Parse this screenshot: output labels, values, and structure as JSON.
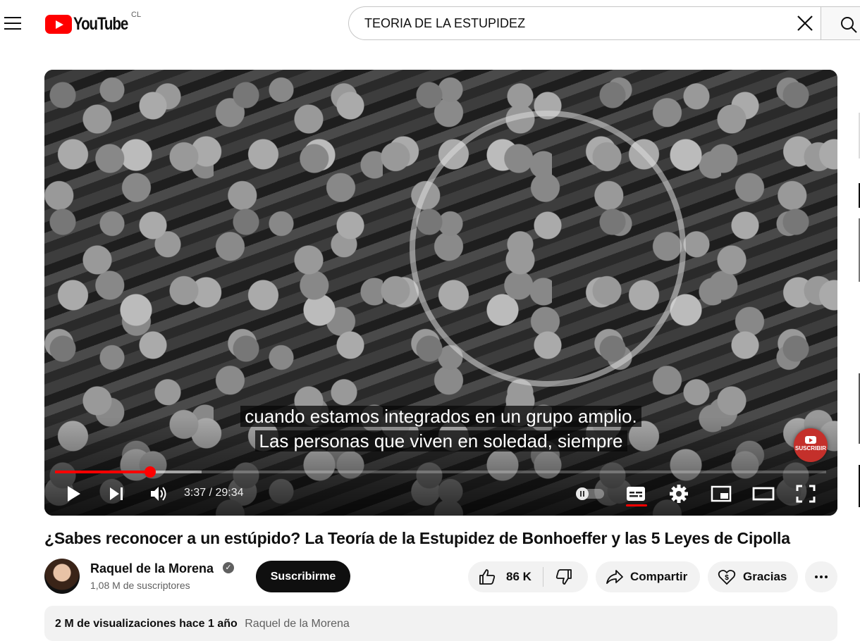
{
  "header": {
    "logo_text": "YouTube",
    "country_code": "CL",
    "search_value": "TEORIA DE LA ESTUPIDEZ"
  },
  "player": {
    "captions": [
      "cuando estamos integrados en un grupo amplio.",
      "Las personas que viven en soledad, siempre"
    ],
    "subscribe_badge_label": "SUSCRIBIR",
    "current_time": "3:37",
    "duration": "29:34",
    "time_display": "3:37 / 29:34",
    "progress_fraction": 0.123,
    "buffered_fraction": 0.19,
    "accent_color": "#ff0000"
  },
  "video": {
    "title": "¿Sabes reconocer a un estúpido? La Teoría de la Estupidez de Bonhoeffer y las 5 Leyes de Cipolla"
  },
  "channel": {
    "name": "Raquel de la Morena",
    "subscribers": "1,08 M de suscriptores",
    "subscribe_label": "Suscribirme"
  },
  "actions": {
    "like_count": "86 K",
    "share_label": "Compartir",
    "thanks_label": "Gracias"
  },
  "description": {
    "views": "2 M de visualizaciones",
    "age": "hace 1 año",
    "channel_tag": "Raquel de la Morena"
  },
  "icons": [
    "menu-icon",
    "youtube-logo-icon",
    "close-icon",
    "search-icon",
    "play-icon",
    "next-icon",
    "volume-icon",
    "autoplay-toggle-icon",
    "captions-icon",
    "settings-icon",
    "miniplayer-icon",
    "theater-icon",
    "fullscreen-icon",
    "like-icon",
    "dislike-icon",
    "share-icon",
    "thanks-icon",
    "more-icon",
    "verified-icon"
  ]
}
